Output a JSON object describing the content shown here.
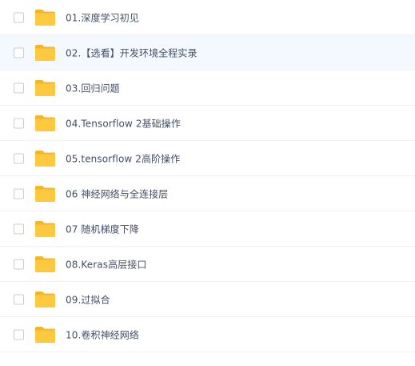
{
  "file_list": {
    "items": [
      {
        "name": "01.深度学习初见",
        "type": "folder",
        "icon": "folder-icon",
        "checked": false
      },
      {
        "name": "02.【选看】开发环境全程实录",
        "type": "folder",
        "icon": "folder-icon",
        "checked": false,
        "hovered": true
      },
      {
        "name": "03.回归问题",
        "type": "folder",
        "icon": "folder-icon",
        "checked": false
      },
      {
        "name": "04.Tensorflow 2基础操作",
        "type": "folder",
        "icon": "folder-icon",
        "checked": false
      },
      {
        "name": "05.tensorflow 2高阶操作",
        "type": "folder",
        "icon": "folder-icon",
        "checked": false
      },
      {
        "name": "06 神经网络与全连接层",
        "type": "folder",
        "icon": "folder-icon",
        "checked": false
      },
      {
        "name": "07 随机梯度下降",
        "type": "folder",
        "icon": "folder-icon",
        "checked": false
      },
      {
        "name": "08.Keras高层接口",
        "type": "folder",
        "icon": "folder-icon",
        "checked": false
      },
      {
        "name": "09.过拟合",
        "type": "folder",
        "icon": "folder-icon",
        "checked": false
      },
      {
        "name": "10.卷积神经网络",
        "type": "folder",
        "icon": "folder-icon",
        "checked": false
      }
    ]
  },
  "colors": {
    "folder": "#ffc93f",
    "folder_tab": "#f5b52a",
    "hover_bg": "#f3f9ff",
    "text": "#424e67",
    "divider": "#eef1f5",
    "checkbox_border": "#c8ccd2"
  }
}
